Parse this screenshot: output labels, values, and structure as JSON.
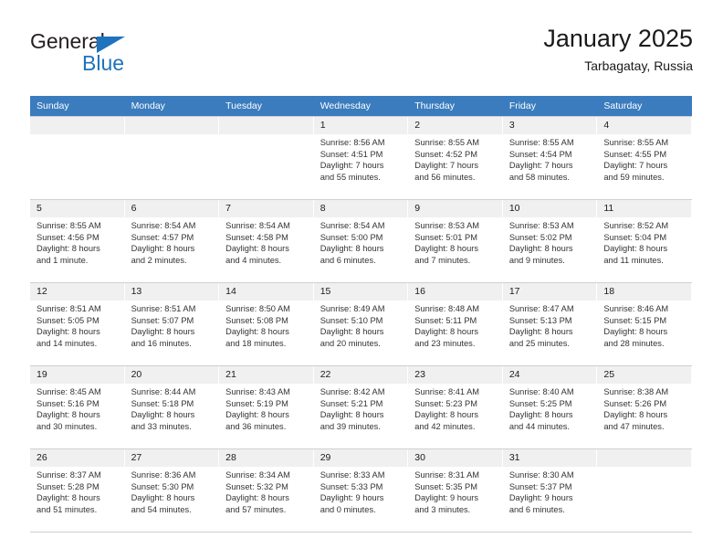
{
  "brand": {
    "name_top": "General",
    "name_bottom": "Blue",
    "logo_icon": "triangle-icon",
    "color_blue": "#1f72bd",
    "color_dark": "#231f20"
  },
  "header": {
    "title": "January 2025",
    "subtitle": "Tarbagatay, Russia"
  },
  "theme": {
    "header_row_bg": "#3a7cbe",
    "daynum_bg": "#f0f0f0",
    "grid_line": "#cfcfcf"
  },
  "weekdays": [
    "Sunday",
    "Monday",
    "Tuesday",
    "Wednesday",
    "Thursday",
    "Friday",
    "Saturday"
  ],
  "weeks": [
    [
      {
        "day": "",
        "empty": true,
        "lines": []
      },
      {
        "day": "",
        "empty": true,
        "lines": []
      },
      {
        "day": "",
        "empty": true,
        "lines": []
      },
      {
        "day": "1",
        "lines": [
          "Sunrise: 8:56 AM",
          "Sunset: 4:51 PM",
          "Daylight: 7 hours",
          "and 55 minutes."
        ]
      },
      {
        "day": "2",
        "lines": [
          "Sunrise: 8:55 AM",
          "Sunset: 4:52 PM",
          "Daylight: 7 hours",
          "and 56 minutes."
        ]
      },
      {
        "day": "3",
        "lines": [
          "Sunrise: 8:55 AM",
          "Sunset: 4:54 PM",
          "Daylight: 7 hours",
          "and 58 minutes."
        ]
      },
      {
        "day": "4",
        "lines": [
          "Sunrise: 8:55 AM",
          "Sunset: 4:55 PM",
          "Daylight: 7 hours",
          "and 59 minutes."
        ]
      }
    ],
    [
      {
        "day": "5",
        "lines": [
          "Sunrise: 8:55 AM",
          "Sunset: 4:56 PM",
          "Daylight: 8 hours",
          "and 1 minute."
        ]
      },
      {
        "day": "6",
        "lines": [
          "Sunrise: 8:54 AM",
          "Sunset: 4:57 PM",
          "Daylight: 8 hours",
          "and 2 minutes."
        ]
      },
      {
        "day": "7",
        "lines": [
          "Sunrise: 8:54 AM",
          "Sunset: 4:58 PM",
          "Daylight: 8 hours",
          "and 4 minutes."
        ]
      },
      {
        "day": "8",
        "lines": [
          "Sunrise: 8:54 AM",
          "Sunset: 5:00 PM",
          "Daylight: 8 hours",
          "and 6 minutes."
        ]
      },
      {
        "day": "9",
        "lines": [
          "Sunrise: 8:53 AM",
          "Sunset: 5:01 PM",
          "Daylight: 8 hours",
          "and 7 minutes."
        ]
      },
      {
        "day": "10",
        "lines": [
          "Sunrise: 8:53 AM",
          "Sunset: 5:02 PM",
          "Daylight: 8 hours",
          "and 9 minutes."
        ]
      },
      {
        "day": "11",
        "lines": [
          "Sunrise: 8:52 AM",
          "Sunset: 5:04 PM",
          "Daylight: 8 hours",
          "and 11 minutes."
        ]
      }
    ],
    [
      {
        "day": "12",
        "lines": [
          "Sunrise: 8:51 AM",
          "Sunset: 5:05 PM",
          "Daylight: 8 hours",
          "and 14 minutes."
        ]
      },
      {
        "day": "13",
        "lines": [
          "Sunrise: 8:51 AM",
          "Sunset: 5:07 PM",
          "Daylight: 8 hours",
          "and 16 minutes."
        ]
      },
      {
        "day": "14",
        "lines": [
          "Sunrise: 8:50 AM",
          "Sunset: 5:08 PM",
          "Daylight: 8 hours",
          "and 18 minutes."
        ]
      },
      {
        "day": "15",
        "lines": [
          "Sunrise: 8:49 AM",
          "Sunset: 5:10 PM",
          "Daylight: 8 hours",
          "and 20 minutes."
        ]
      },
      {
        "day": "16",
        "lines": [
          "Sunrise: 8:48 AM",
          "Sunset: 5:11 PM",
          "Daylight: 8 hours",
          "and 23 minutes."
        ]
      },
      {
        "day": "17",
        "lines": [
          "Sunrise: 8:47 AM",
          "Sunset: 5:13 PM",
          "Daylight: 8 hours",
          "and 25 minutes."
        ]
      },
      {
        "day": "18",
        "lines": [
          "Sunrise: 8:46 AM",
          "Sunset: 5:15 PM",
          "Daylight: 8 hours",
          "and 28 minutes."
        ]
      }
    ],
    [
      {
        "day": "19",
        "lines": [
          "Sunrise: 8:45 AM",
          "Sunset: 5:16 PM",
          "Daylight: 8 hours",
          "and 30 minutes."
        ]
      },
      {
        "day": "20",
        "lines": [
          "Sunrise: 8:44 AM",
          "Sunset: 5:18 PM",
          "Daylight: 8 hours",
          "and 33 minutes."
        ]
      },
      {
        "day": "21",
        "lines": [
          "Sunrise: 8:43 AM",
          "Sunset: 5:19 PM",
          "Daylight: 8 hours",
          "and 36 minutes."
        ]
      },
      {
        "day": "22",
        "lines": [
          "Sunrise: 8:42 AM",
          "Sunset: 5:21 PM",
          "Daylight: 8 hours",
          "and 39 minutes."
        ]
      },
      {
        "day": "23",
        "lines": [
          "Sunrise: 8:41 AM",
          "Sunset: 5:23 PM",
          "Daylight: 8 hours",
          "and 42 minutes."
        ]
      },
      {
        "day": "24",
        "lines": [
          "Sunrise: 8:40 AM",
          "Sunset: 5:25 PM",
          "Daylight: 8 hours",
          "and 44 minutes."
        ]
      },
      {
        "day": "25",
        "lines": [
          "Sunrise: 8:38 AM",
          "Sunset: 5:26 PM",
          "Daylight: 8 hours",
          "and 47 minutes."
        ]
      }
    ],
    [
      {
        "day": "26",
        "lines": [
          "Sunrise: 8:37 AM",
          "Sunset: 5:28 PM",
          "Daylight: 8 hours",
          "and 51 minutes."
        ]
      },
      {
        "day": "27",
        "lines": [
          "Sunrise: 8:36 AM",
          "Sunset: 5:30 PM",
          "Daylight: 8 hours",
          "and 54 minutes."
        ]
      },
      {
        "day": "28",
        "lines": [
          "Sunrise: 8:34 AM",
          "Sunset: 5:32 PM",
          "Daylight: 8 hours",
          "and 57 minutes."
        ]
      },
      {
        "day": "29",
        "lines": [
          "Sunrise: 8:33 AM",
          "Sunset: 5:33 PM",
          "Daylight: 9 hours",
          "and 0 minutes."
        ]
      },
      {
        "day": "30",
        "lines": [
          "Sunrise: 8:31 AM",
          "Sunset: 5:35 PM",
          "Daylight: 9 hours",
          "and 3 minutes."
        ]
      },
      {
        "day": "31",
        "lines": [
          "Sunrise: 8:30 AM",
          "Sunset: 5:37 PM",
          "Daylight: 9 hours",
          "and 6 minutes."
        ]
      },
      {
        "day": "",
        "empty": true,
        "lines": []
      }
    ]
  ]
}
